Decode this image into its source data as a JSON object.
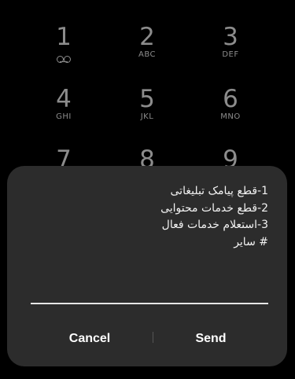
{
  "dialpad": {
    "keys": [
      {
        "digit": "1",
        "letters": "",
        "icon": "voicemail-icon"
      },
      {
        "digit": "2",
        "letters": "ABC"
      },
      {
        "digit": "3",
        "letters": "DEF"
      },
      {
        "digit": "4",
        "letters": "GHI"
      },
      {
        "digit": "5",
        "letters": "JKL"
      },
      {
        "digit": "6",
        "letters": "MNO"
      },
      {
        "digit": "7",
        "letters": ""
      },
      {
        "digit": "8",
        "letters": ""
      },
      {
        "digit": "9",
        "letters": ""
      }
    ]
  },
  "dialog": {
    "lines": [
      "1-قطع پیامک تبلیغاتی",
      "2-قطع خدمات محتوایی",
      "3-استعلام خدمات فعال",
      "# سایر"
    ],
    "input_value": "",
    "cancel_label": "Cancel",
    "send_label": "Send"
  },
  "colors": {
    "background": "#000000",
    "dialog": "#2c2c2c",
    "key_text": "#8c8c8c",
    "dialog_text": "#f2f2f2"
  }
}
